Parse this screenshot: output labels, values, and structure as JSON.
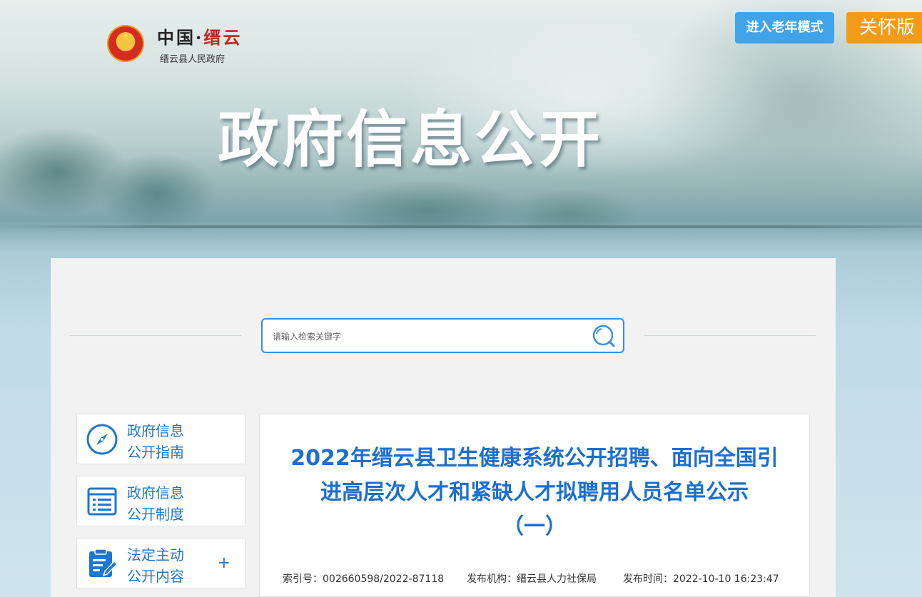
{
  "header": {
    "logo_title_part1": "中国·",
    "logo_title_part2": "缙云",
    "logo_subtitle": "缙云县人民政府",
    "hero_title": "政府信息公开",
    "elder_mode_label": "进入老年模式",
    "care_version_label": "关怀版"
  },
  "search": {
    "placeholder": "请输入检索关键字",
    "value": ""
  },
  "sidebar": {
    "items": [
      {
        "line1": "政府信息",
        "line2": "公开指南",
        "icon": "compass-icon"
      },
      {
        "line1": "政府信息",
        "line2": "公开制度",
        "icon": "list-document-icon"
      },
      {
        "line1": "法定主动",
        "line2": "公开内容",
        "icon": "clipboard-edit-icon",
        "expand": "+"
      }
    ]
  },
  "article": {
    "title_line1": "2022年缙云县卫生健康系统公开招聘、面向全国引",
    "title_line2": "进高层次人才和紧缺人才拟聘用人员名单公示",
    "title_line3": "（一）",
    "index_label": "索引号：",
    "index_value": "002660598/2022-87118",
    "org_label": "发布机构：",
    "org_value": "缙云县人力社保局",
    "time_label": "发布时间：",
    "time_value": "2022-10-10 16:23:47"
  },
  "colors": {
    "primary_blue": "#1c77d2",
    "elder_button": "#41a3ea",
    "care_button": "#f39a17"
  }
}
